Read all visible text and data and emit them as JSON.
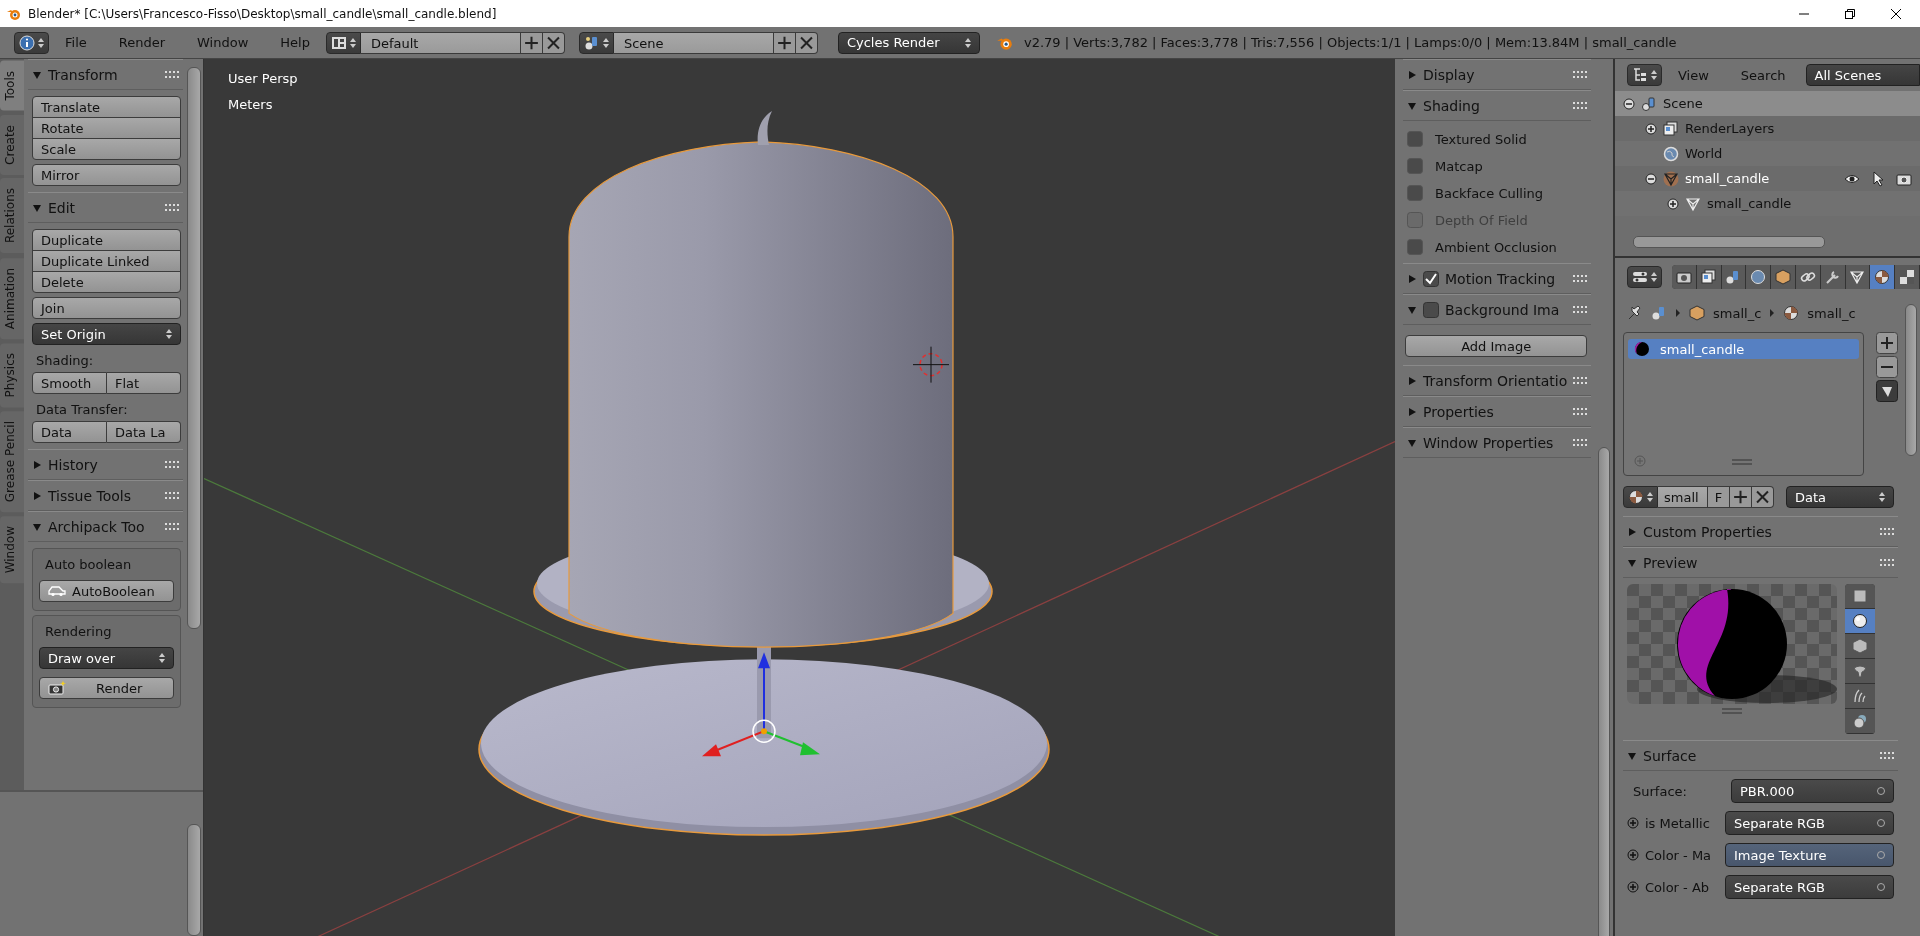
{
  "window": {
    "title": "Blender* [C:\\Users\\Francesco-Fisso\\Desktop\\small_candle\\small_candle.blend]"
  },
  "header": {
    "menus": [
      "File",
      "Render",
      "Window",
      "Help"
    ],
    "layout": "Default",
    "scene": "Scene",
    "engine": "Cycles Render",
    "stats": "v2.79 | Verts:3,782 | Faces:3,778 | Tris:7,556 | Objects:1/1 | Lamps:0/0 | Mem:13.84M | small_candle"
  },
  "tool_tabs": [
    {
      "label": "Tools",
      "selected": true
    },
    {
      "label": "Create",
      "selected": false
    },
    {
      "label": "Relations",
      "selected": false
    },
    {
      "label": "Animation",
      "selected": false
    },
    {
      "label": "Physics",
      "selected": false
    },
    {
      "label": "Grease Pencil",
      "selected": false
    },
    {
      "label": "Window",
      "selected": false
    }
  ],
  "tool_panels": [
    {
      "title": "Transform",
      "expanded": true,
      "items": [
        {
          "kind": "buttons",
          "labels": [
            "Translate",
            "Rotate",
            "Scale"
          ]
        },
        {
          "kind": "buttons",
          "labels": [
            "Mirror"
          ]
        }
      ]
    },
    {
      "title": "Edit",
      "expanded": true,
      "items": [
        {
          "kind": "buttons",
          "labels": [
            "Duplicate",
            "Duplicate Linked",
            "Delete"
          ]
        },
        {
          "kind": "buttons",
          "labels": [
            "Join"
          ]
        },
        {
          "kind": "dropdown",
          "value": "Set Origin"
        },
        {
          "kind": "label",
          "text": "Shading:"
        },
        {
          "kind": "row",
          "labels": [
            "Smooth",
            "Flat"
          ]
        },
        {
          "kind": "label",
          "text": "Data Transfer:"
        },
        {
          "kind": "row",
          "labels": [
            "Data",
            "Data La"
          ]
        }
      ]
    },
    {
      "title": "History",
      "expanded": false
    },
    {
      "title": "Tissue Tools",
      "expanded": false
    }
  ],
  "archipack": {
    "title": "Archipack Too",
    "expanded": true,
    "auto_boolean": {
      "label": "Auto boolean",
      "button": "AutoBoolean"
    },
    "rendering": {
      "label": "Rendering",
      "dropdown": "Draw over",
      "button": "Render"
    }
  },
  "viewport": {
    "view_name": "User Persp",
    "units": "Meters"
  },
  "view_panels": [
    {
      "title": "Display",
      "expanded": false
    },
    {
      "title": "Shading",
      "expanded": true,
      "options": [
        {
          "label": "Textured Solid",
          "checked": false,
          "disabled": false
        },
        {
          "label": "Matcap",
          "checked": false,
          "disabled": false
        },
        {
          "label": "Backface Culling",
          "checked": false,
          "disabled": false
        },
        {
          "label": "Depth Of Field",
          "checked": false,
          "disabled": true
        },
        {
          "label": "Ambient Occlusion",
          "checked": false,
          "disabled": false
        }
      ]
    },
    {
      "title": "Motion Tracking",
      "expanded": false,
      "checked": true
    },
    {
      "title": "Background Ima",
      "expanded": true,
      "checked": false,
      "button": "Add Image"
    },
    {
      "title": "Transform Orientatio",
      "expanded": false
    },
    {
      "title": "Properties",
      "expanded": false
    },
    {
      "title": "Window Properties",
      "expanded": true
    }
  ],
  "outliner": {
    "menus": [
      "View",
      "Search"
    ],
    "filter": "All Scenes",
    "tree": [
      {
        "label": "Scene",
        "kind": "scene",
        "expanded": true,
        "selected": true,
        "active": false,
        "children": [
          {
            "label": "RenderLayers",
            "kind": "render_layers",
            "expanded": false,
            "selected": false,
            "active": false
          },
          {
            "label": "World",
            "kind": "world",
            "selected": false,
            "active": false
          },
          {
            "label": "small_candle",
            "kind": "object",
            "expanded": true,
            "selected": false,
            "active": true,
            "children": [
              {
                "label": "small_candle",
                "kind": "mesh",
                "expanded": false,
                "selected": false,
                "active": false
              }
            ]
          }
        ]
      }
    ]
  },
  "properties": {
    "tabs": [
      {
        "kind": "render",
        "selected": false
      },
      {
        "kind": "render_layers",
        "selected": false
      },
      {
        "kind": "scene",
        "selected": false
      },
      {
        "kind": "world",
        "selected": false
      },
      {
        "kind": "object",
        "selected": false
      },
      {
        "kind": "constraints",
        "selected": false
      },
      {
        "kind": "modifiers",
        "selected": false
      },
      {
        "kind": "data",
        "selected": false
      },
      {
        "kind": "material",
        "selected": true
      },
      {
        "kind": "texture",
        "selected": false
      }
    ],
    "breadcrumb": [
      "small_c",
      "small_c"
    ],
    "material_slots": [
      {
        "label": "small_candle",
        "selected": true
      }
    ],
    "datablock": {
      "name": "small",
      "fake_user": "F",
      "link": "Data"
    },
    "custom_properties": {
      "title": "Custom Properties",
      "expanded": false
    },
    "preview": {
      "title": "Preview",
      "expanded": true,
      "shapes": [
        {
          "kind": "plane",
          "selected": false
        },
        {
          "kind": "sphere",
          "selected": true
        },
        {
          "kind": "cube",
          "selected": false
        },
        {
          "kind": "monkey",
          "selected": false
        },
        {
          "kind": "hair",
          "selected": false
        },
        {
          "kind": "world_sphere",
          "selected": false
        }
      ]
    },
    "surface": {
      "title": "Surface",
      "expanded": true,
      "surface_label": "Surface:",
      "surface_value": "PBR.000",
      "inputs": [
        {
          "label": "is Metallic",
          "value": "Separate RGB",
          "highlighted": false
        },
        {
          "label": "Color - Ma",
          "value": "Image Texture",
          "highlighted": true
        },
        {
          "label": "Color - Ab",
          "value": "Separate RGB",
          "highlighted": false
        }
      ]
    }
  }
}
